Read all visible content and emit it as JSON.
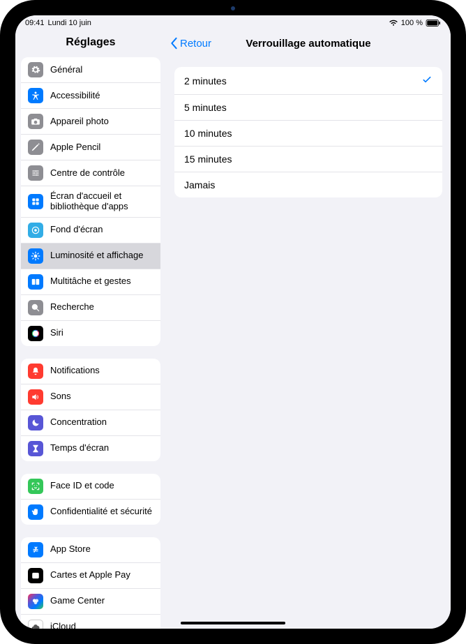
{
  "status": {
    "time": "09:41",
    "date": "Lundi 10 juin",
    "battery_pct": "100 %"
  },
  "sidebar": {
    "title": "Réglages",
    "groups": [
      {
        "items": [
          {
            "label": "Général",
            "icon": "gear-icon",
            "bg": "bg-gray"
          },
          {
            "label": "Accessibilité",
            "icon": "accessibility-icon",
            "bg": "bg-blue"
          },
          {
            "label": "Appareil photo",
            "icon": "camera-icon",
            "bg": "bg-gray"
          },
          {
            "label": "Apple Pencil",
            "icon": "pencil-icon",
            "bg": "bg-gray"
          },
          {
            "label": "Centre de contrôle",
            "icon": "controls-icon",
            "bg": "bg-gray"
          },
          {
            "label": "Écran d'accueil et bibliothèque d'apps",
            "icon": "apps-icon",
            "bg": "bg-blue"
          },
          {
            "label": "Fond d'écran",
            "icon": "wallpaper-icon",
            "bg": "bg-cyan"
          },
          {
            "label": "Luminosité et affichage",
            "icon": "brightness-icon",
            "bg": "bg-blue",
            "selected": true
          },
          {
            "label": "Multitâche et gestes",
            "icon": "multitask-icon",
            "bg": "bg-blue"
          },
          {
            "label": "Recherche",
            "icon": "search-icon",
            "bg": "bg-gray"
          },
          {
            "label": "Siri",
            "icon": "siri-icon",
            "bg": "bg-black"
          }
        ]
      },
      {
        "items": [
          {
            "label": "Notifications",
            "icon": "bell-icon",
            "bg": "bg-red"
          },
          {
            "label": "Sons",
            "icon": "sound-icon",
            "bg": "bg-red"
          },
          {
            "label": "Concentration",
            "icon": "moon-icon",
            "bg": "bg-indigo"
          },
          {
            "label": "Temps d'écran",
            "icon": "hourglass-icon",
            "bg": "bg-indigo"
          }
        ]
      },
      {
        "items": [
          {
            "label": "Face ID et code",
            "icon": "faceid-icon",
            "bg": "bg-green"
          },
          {
            "label": "Confidentialité et sécurité",
            "icon": "hand-icon",
            "bg": "bg-blue"
          }
        ]
      },
      {
        "items": [
          {
            "label": "App Store",
            "icon": "appstore-icon",
            "bg": "bg-blue"
          },
          {
            "label": "Cartes et Apple Pay",
            "icon": "wallet-icon",
            "bg": "bg-black"
          },
          {
            "label": "Game Center",
            "icon": "gamecenter-icon",
            "bg": "bg-multicolor"
          },
          {
            "label": "iCloud",
            "icon": "cloud-icon",
            "bg": "bg-white"
          }
        ]
      }
    ]
  },
  "detail": {
    "back_label": "Retour",
    "title": "Verrouillage automatique",
    "options": [
      {
        "label": "2 minutes",
        "checked": true
      },
      {
        "label": "5 minutes",
        "checked": false
      },
      {
        "label": "10 minutes",
        "checked": false
      },
      {
        "label": "15 minutes",
        "checked": false
      },
      {
        "label": "Jamais",
        "checked": false
      }
    ]
  }
}
